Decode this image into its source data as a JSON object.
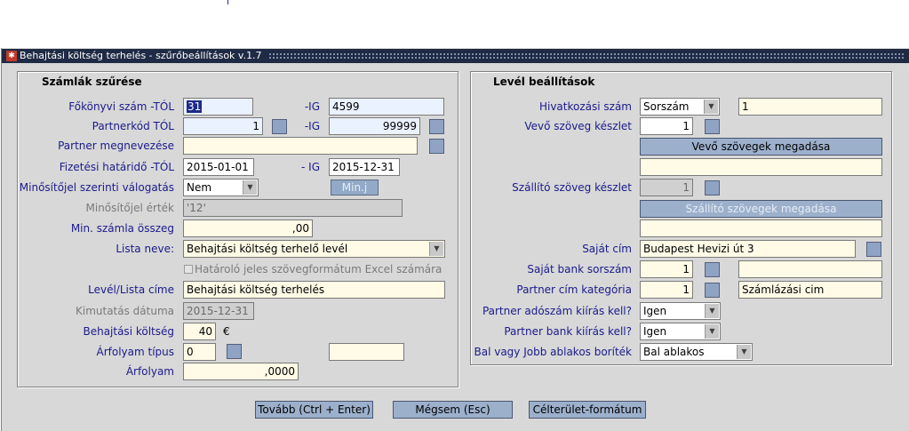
{
  "window": {
    "title": "Behajtási költség terhelés - szűrőbeállítások v.1.7",
    "icon": "app-icon"
  },
  "left": {
    "title": "Számlák szűrése",
    "fokonyvi_tol_label": "Főkönyvi szám -TÓL",
    "fokonyvi_tol": "31",
    "fokonyvi_ig_label": "-IG",
    "fokonyvi_ig": "4599",
    "partnerkod_tol_label": "Partnerkód TÓL",
    "partnerkod_tol": "1",
    "partnerkod_ig_label": "-IG",
    "partnerkod_ig": "99999",
    "partner_nev_label": "Partner megnevezése",
    "partner_nev": "",
    "fizetesi_label": "Fizetési határidő -TÓL",
    "fizetesi_tol": "2015-01-01",
    "fizetesi_ig_label": "- IG",
    "fizetesi_ig": "2015-12-31",
    "minosito_label": "Minősítőjel szerinti válogatás",
    "minosito_value": "Nem",
    "minj_button": "Min.j",
    "minosito_ertek_label": "Minősítőjel érték",
    "minosito_ertek": "'12'",
    "min_szamla_label": "Min. számla összeg",
    "min_szamla": ",00",
    "lista_neve_label": "Lista neve:",
    "lista_neve": "Behajtási költség terhelő levél",
    "hatarolo_checkbox": "Határoló jeles szövegformátum  Excel számára",
    "level_cime_label": "Levél/Lista címe",
    "level_cime": "Behajtási költség terhelés",
    "kimutatas_label": "Kimutatás dátuma",
    "kimutatas": "2015-12-31",
    "behajtasi_label": "Behajtási költség",
    "behajtasi": "40",
    "currency": "€",
    "arfolyam_tipus_label": "Árfolyam típus",
    "arfolyam_tipus": "0",
    "arfolyam_tipus_extra": "",
    "arfolyam_label": "Árfolyam",
    "arfolyam": ",0000"
  },
  "right": {
    "title": "Levél beállítások",
    "hivatkozasi_label": "Hivatkozási szám",
    "hivatkozasi_value": "Sorszám",
    "hivatkozasi_num": "1",
    "vevo_keszlet_label": "Vevő szöveg készlet",
    "vevo_keszlet": "1",
    "vevo_button": "Vevő szövegek megadása",
    "vevo_text": "",
    "szallito_keszlet_label": "Szállító szöveg készlet",
    "szallito_keszlet": "1",
    "szallito_button": "Szállító szövegek megadása",
    "szallito_text": "",
    "sajat_cim_label": "Saját cím",
    "sajat_cim": "Budapest Hevizi út 3",
    "sajat_bank_label": "Saját bank sorszám",
    "sajat_bank": "1",
    "sajat_bank_extra": "",
    "partner_cim_label": "Partner cím kategória",
    "partner_cim": "1",
    "partner_cim_text": "Számlázási cim",
    "adoszam_label": "Partner adószám kiírás kell?",
    "adoszam_value": "Igen",
    "bank_kiiras_label": "Partner bank kiírás kell?",
    "bank_kiiras_value": "Igen",
    "ablakos_label": "Bal vagy Jobb ablakos boríték",
    "ablakos_value": "Bal ablakos"
  },
  "buttons": {
    "tovabb": "Tovább (Ctrl + Enter)",
    "megsem": "Mégsem (Esc)",
    "celterulet": "Célterület-formátum"
  },
  "colors": {
    "label": "#1a1a8c",
    "titlebar": "#1f2a44",
    "button": "#9cb0cc"
  }
}
